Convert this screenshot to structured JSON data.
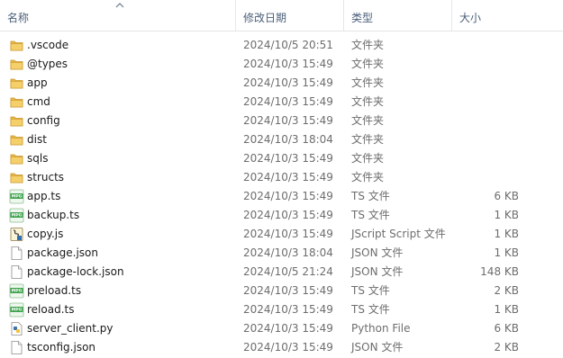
{
  "columns": {
    "name": "名称",
    "date": "修改日期",
    "type": "类型",
    "size": "大小"
  },
  "files": [
    {
      "name": ".vscode",
      "date": "2024/10/5 20:51",
      "type": "文件夹",
      "size": "",
      "icon": "folder-icon"
    },
    {
      "name": "@types",
      "date": "2024/10/3 15:49",
      "type": "文件夹",
      "size": "",
      "icon": "folder-icon"
    },
    {
      "name": "app",
      "date": "2024/10/3 15:49",
      "type": "文件夹",
      "size": "",
      "icon": "folder-icon"
    },
    {
      "name": "cmd",
      "date": "2024/10/3 15:49",
      "type": "文件夹",
      "size": "",
      "icon": "folder-icon"
    },
    {
      "name": "config",
      "date": "2024/10/3 15:49",
      "type": "文件夹",
      "size": "",
      "icon": "folder-icon"
    },
    {
      "name": "dist",
      "date": "2024/10/3 18:04",
      "type": "文件夹",
      "size": "",
      "icon": "folder-icon"
    },
    {
      "name": "sqls",
      "date": "2024/10/3 15:49",
      "type": "文件夹",
      "size": "",
      "icon": "folder-icon"
    },
    {
      "name": "structs",
      "date": "2024/10/3 15:49",
      "type": "文件夹",
      "size": "",
      "icon": "folder-icon"
    },
    {
      "name": "app.ts",
      "date": "2024/10/3 15:49",
      "type": "TS 文件",
      "size": "6 KB",
      "icon": "mpg-file-icon"
    },
    {
      "name": "backup.ts",
      "date": "2024/10/3 15:49",
      "type": "TS 文件",
      "size": "1 KB",
      "icon": "mpg-file-icon"
    },
    {
      "name": "copy.js",
      "date": "2024/10/3 15:49",
      "type": "JScript Script 文件",
      "size": "1 KB",
      "icon": "script-file-icon"
    },
    {
      "name": "package.json",
      "date": "2024/10/3 18:04",
      "type": "JSON 文件",
      "size": "1 KB",
      "icon": "blank-file-icon"
    },
    {
      "name": "package-lock.json",
      "date": "2024/10/5 21:24",
      "type": "JSON 文件",
      "size": "148 KB",
      "icon": "blank-file-icon"
    },
    {
      "name": "preload.ts",
      "date": "2024/10/3 15:49",
      "type": "TS 文件",
      "size": "2 KB",
      "icon": "mpg-file-icon"
    },
    {
      "name": "reload.ts",
      "date": "2024/10/3 15:49",
      "type": "TS 文件",
      "size": "1 KB",
      "icon": "mpg-file-icon"
    },
    {
      "name": "server_client.py",
      "date": "2024/10/3 15:49",
      "type": "Python File",
      "size": "6 KB",
      "icon": "python-file-icon"
    },
    {
      "name": "tsconfig.json",
      "date": "2024/10/3 15:49",
      "type": "JSON 文件",
      "size": "2 KB",
      "icon": "blank-file-icon"
    }
  ],
  "colors": {
    "header_text": "#4c607a",
    "folder": "#e8b84a",
    "mpg_green": "#3aa14a"
  }
}
